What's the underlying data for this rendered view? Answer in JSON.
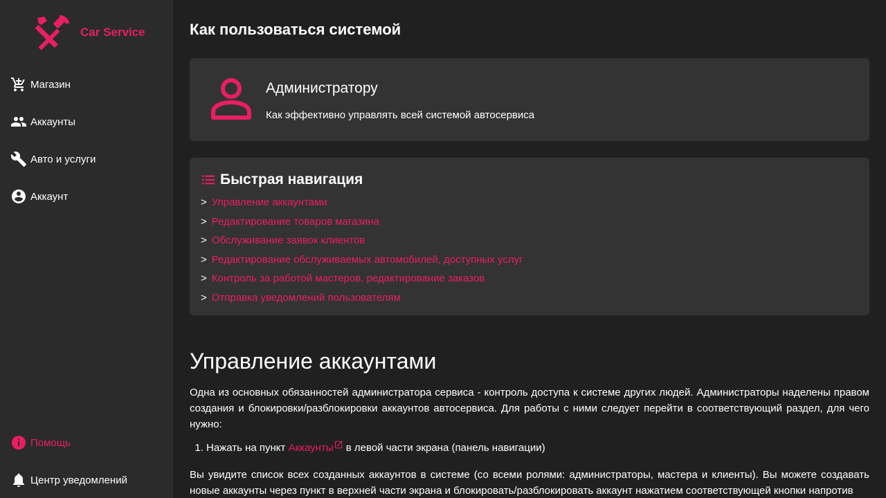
{
  "app": {
    "name": "Car Service",
    "accent": "#e91e63"
  },
  "sidebar": {
    "items": [
      {
        "label": "Магазин",
        "icon": "cart-icon"
      },
      {
        "label": "Аккаунты",
        "icon": "people-icon"
      },
      {
        "label": "Авто и услуги",
        "icon": "wrench-icon"
      },
      {
        "label": "Аккаунт",
        "icon": "account-circle-icon"
      }
    ],
    "bottom": [
      {
        "label": "Помощь",
        "icon": "info-icon"
      },
      {
        "label": "Центр уведомлений",
        "icon": "bell-icon"
      }
    ]
  },
  "main": {
    "title": "Как пользоваться системой",
    "role_card": {
      "title": "Администратору",
      "description": "Как эффективно управлять всей системой автосервиса"
    },
    "quick_nav": {
      "title": "Быстрая навигация",
      "arrow": ">",
      "links": [
        "Управление аккаунтами",
        "Редактирование товаров магазина",
        "Обслуживание заявок клиентов",
        "Редактирование обслуживаемых автомобилей, доступных услуг",
        "Контроль за работой мастеров, редактирование заказов",
        "Отправка уведомлений пользователям"
      ]
    },
    "section": {
      "title": "Управление аккаунтами",
      "para1": "Одна из основных обязанностей администратора сервиса - контроль доступа к системе других людей. Администраторы наделены правом создания и блокировки/разблокировки аккаунтов автосервиса. Для работы с ними следует перейти в соответствующий раздел, для чего нужно:",
      "step1_prefix": "Нажать на пункт ",
      "step1_link": "Аккаунты",
      "step1_suffix": " в левой части экрана (панель навигации)",
      "para2": "Вы увидите список всех созданных аккаунтов в системе (со всеми ролями: администраторы, мастера и клиенты). Вы можете создавать новые аккаунты через пункт в верхней части экрана и блокировать/разблокировать аккаунт нажатием соответствующей кнопки напротив"
    }
  }
}
